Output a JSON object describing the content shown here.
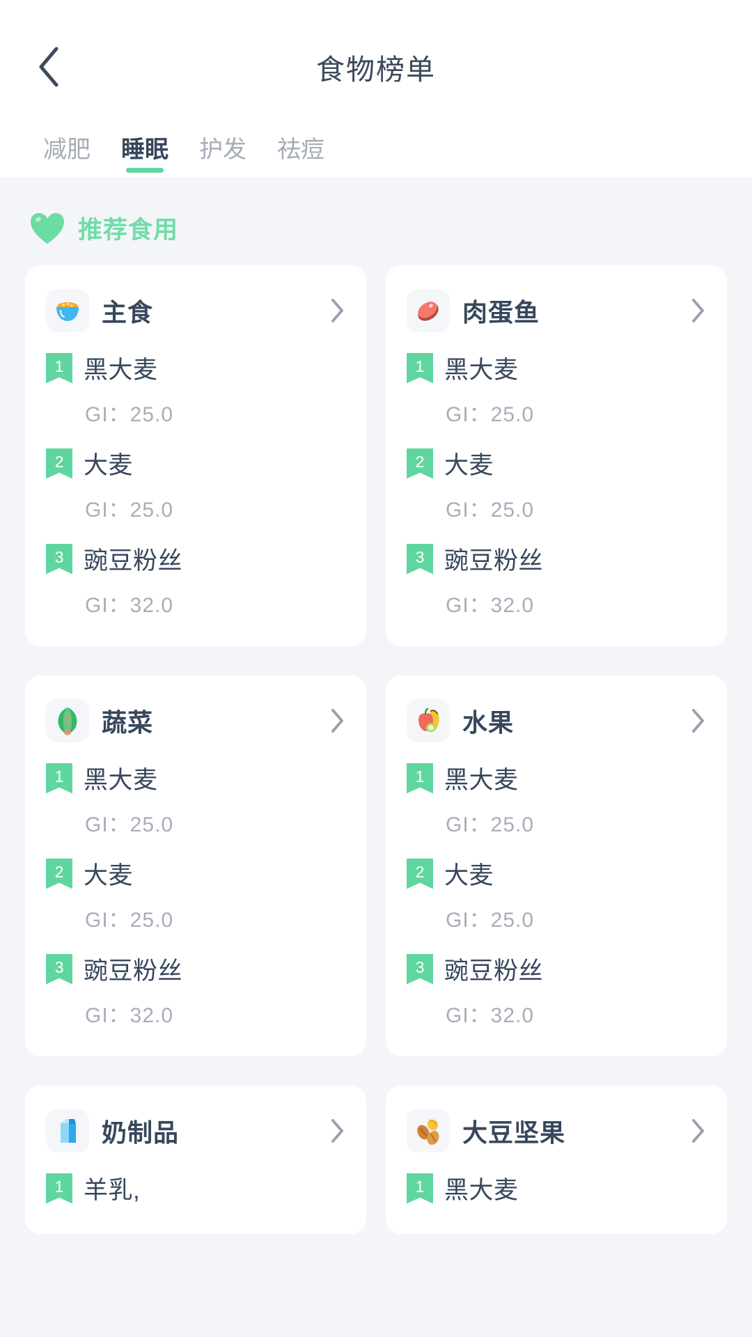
{
  "header": {
    "title": "食物榜单",
    "back_icon": "chevron-left-icon"
  },
  "tabs": [
    {
      "label": "减肥",
      "active": false
    },
    {
      "label": "睡眠",
      "active": true
    },
    {
      "label": "护发",
      "active": false
    },
    {
      "label": "祛痘",
      "active": false
    }
  ],
  "section": {
    "icon": "heart-icon",
    "title": "推荐食用",
    "accent_color": "#6fdda6"
  },
  "colors": {
    "accent_green": "#5fd69f",
    "title_text": "#37475c",
    "muted_text": "#a8adb8",
    "page_bg": "#f4f5f9",
    "card_bg": "#ffffff"
  },
  "cards": [
    {
      "name": "主食",
      "icon": "rice-bowl-icon",
      "chevron": "chevron-right-icon",
      "items": [
        {
          "rank": "1",
          "food": "黑大麦",
          "gi": "GI：25.0"
        },
        {
          "rank": "2",
          "food": "大麦",
          "gi": "GI：25.0"
        },
        {
          "rank": "3",
          "food": "豌豆粉丝",
          "gi": "GI：32.0"
        }
      ]
    },
    {
      "name": "肉蛋鱼",
      "icon": "meat-icon",
      "chevron": "chevron-right-icon",
      "items": [
        {
          "rank": "1",
          "food": "黑大麦",
          "gi": "GI：25.0"
        },
        {
          "rank": "2",
          "food": "大麦",
          "gi": "GI：25.0"
        },
        {
          "rank": "3",
          "food": "豌豆粉丝",
          "gi": "GI：32.0"
        }
      ]
    },
    {
      "name": "蔬菜",
      "icon": "leafy-green-icon",
      "chevron": "chevron-right-icon",
      "items": [
        {
          "rank": "1",
          "food": "黑大麦",
          "gi": "GI：25.0"
        },
        {
          "rank": "2",
          "food": "大麦",
          "gi": "GI：25.0"
        },
        {
          "rank": "3",
          "food": "豌豆粉丝",
          "gi": "GI：32.0"
        }
      ]
    },
    {
      "name": "水果",
      "icon": "fruit-icon",
      "chevron": "chevron-right-icon",
      "items": [
        {
          "rank": "1",
          "food": "黑大麦",
          "gi": "GI：25.0"
        },
        {
          "rank": "2",
          "food": "大麦",
          "gi": "GI：25.0"
        },
        {
          "rank": "3",
          "food": "豌豆粉丝",
          "gi": "GI：32.0"
        }
      ]
    },
    {
      "name": "奶制品",
      "icon": "milk-carton-icon",
      "chevron": "chevron-right-icon",
      "items": [
        {
          "rank": "1",
          "food": "羊乳,",
          "gi": ""
        }
      ]
    },
    {
      "name": "大豆坚果",
      "icon": "nuts-icon",
      "chevron": "chevron-right-icon",
      "items": [
        {
          "rank": "1",
          "food": "黑大麦",
          "gi": ""
        }
      ]
    }
  ]
}
